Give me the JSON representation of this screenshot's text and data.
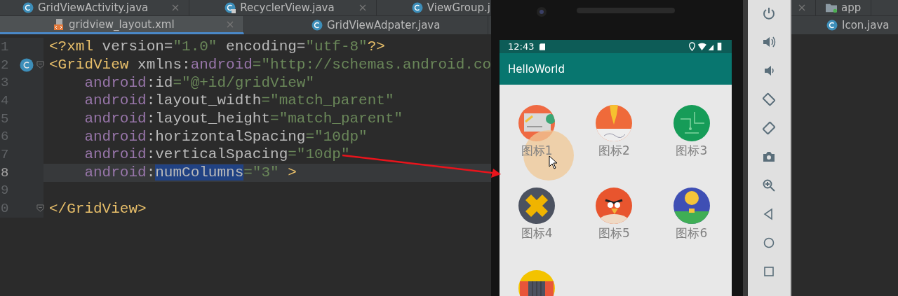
{
  "editor": {
    "tabs_top": [
      {
        "label": "GridViewActivity.java",
        "kind": "java",
        "closable": true
      },
      {
        "label": "RecyclerView.java",
        "kind": "java-locked",
        "closable": true
      },
      {
        "label": "ViewGroup.j",
        "kind": "java",
        "closable": false
      }
    ],
    "tabs": [
      {
        "label": "gridview_layout.xml",
        "kind": "xml",
        "selected": true,
        "closable": true
      },
      {
        "label": "GridViewAdpater.java",
        "kind": "java",
        "selected": false,
        "closable": false
      }
    ],
    "lines": [
      {
        "number": "1",
        "current": false,
        "class_marker": false,
        "fold": false,
        "tokens": [
          {
            "kind": "tag",
            "t": "<?xml"
          },
          {
            "kind": "attr",
            "t": " version="
          },
          {
            "kind": "value",
            "t": "\"1.0\""
          },
          {
            "kind": "attr",
            "t": " encoding="
          },
          {
            "kind": "value",
            "t": "\"utf-8\""
          },
          {
            "kind": "tag",
            "t": "?>"
          }
        ]
      },
      {
        "number": "2",
        "current": false,
        "class_marker": true,
        "fold": true,
        "tokens": [
          {
            "kind": "tag",
            "t": "<GridView"
          },
          {
            "kind": "attr",
            "t": " xmlns:"
          },
          {
            "kind": "ns",
            "t": "android"
          },
          {
            "kind": "value",
            "t": "=\"http://schemas.android.co"
          }
        ]
      },
      {
        "number": "3",
        "current": false,
        "class_marker": false,
        "fold": false,
        "tokens": [
          {
            "kind": "ns",
            "t": "    android"
          },
          {
            "kind": "attr",
            "t": ":id"
          },
          {
            "kind": "value",
            "t": "=\"@+id/gridView\""
          }
        ]
      },
      {
        "number": "4",
        "current": false,
        "class_marker": false,
        "fold": false,
        "tokens": [
          {
            "kind": "ns",
            "t": "    android"
          },
          {
            "kind": "attr",
            "t": ":layout_width"
          },
          {
            "kind": "value",
            "t": "=\"match_parent\""
          }
        ]
      },
      {
        "number": "5",
        "current": false,
        "class_marker": false,
        "fold": false,
        "tokens": [
          {
            "kind": "ns",
            "t": "    android"
          },
          {
            "kind": "attr",
            "t": ":layout_height"
          },
          {
            "kind": "value",
            "t": "=\"match_parent\""
          }
        ]
      },
      {
        "number": "6",
        "current": false,
        "class_marker": false,
        "fold": false,
        "tokens": [
          {
            "kind": "ns",
            "t": "    android"
          },
          {
            "kind": "attr",
            "t": ":horizontalSpacing"
          },
          {
            "kind": "value",
            "t": "=\"10dp\""
          }
        ]
      },
      {
        "number": "7",
        "current": false,
        "class_marker": false,
        "fold": false,
        "tokens": [
          {
            "kind": "ns",
            "t": "    android"
          },
          {
            "kind": "attr",
            "t": ":verticalSpacing"
          },
          {
            "kind": "value",
            "t": "=\"10dp\""
          }
        ]
      },
      {
        "number": "8",
        "current": true,
        "class_marker": false,
        "fold": false,
        "tokens": [
          {
            "kind": "ns",
            "t": "    android"
          },
          {
            "kind": "attr",
            "t": ":"
          },
          {
            "kind": "sel",
            "t": "numColumns"
          },
          {
            "kind": "value",
            "t": "=\"3\""
          },
          {
            "kind": "tag",
            "t": " >"
          }
        ]
      },
      {
        "number": "9",
        "current": false,
        "class_marker": false,
        "fold": false
      },
      {
        "number": "0",
        "current": false,
        "class_marker": false,
        "fold": true,
        "tokens": [
          {
            "kind": "tag",
            "t": "</GridView>"
          }
        ]
      }
    ]
  },
  "phone": {
    "time": "12:43",
    "app_title": "HelloWorld",
    "items": [
      {
        "label": "图标1",
        "kind": "card",
        "pressed": true
      },
      {
        "label": "图标2",
        "kind": "pen",
        "pressed": false
      },
      {
        "label": "图标3",
        "kind": "circuit",
        "pressed": false
      },
      {
        "label": "图标4",
        "kind": "bandage",
        "pressed": false
      },
      {
        "label": "图标5",
        "kind": "bird",
        "pressed": false
      },
      {
        "label": "图标6",
        "kind": "balloon",
        "pressed": false
      },
      {
        "kind": "accordion",
        "pressed": false
      }
    ]
  },
  "right_panel": {
    "tabs_top": [
      {
        "label": "app",
        "kind": "folder"
      }
    ],
    "tabs": [
      {
        "label": "Icon.java",
        "kind": "java"
      }
    ]
  }
}
